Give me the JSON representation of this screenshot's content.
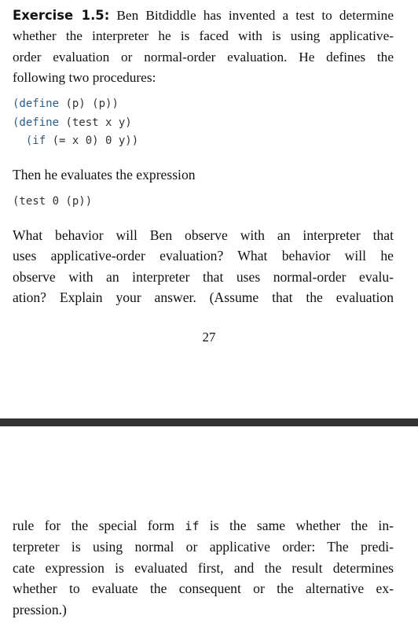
{
  "exercise": {
    "heading": "Exercise 1.5:",
    "intro_lines": [
      "Ben Bitdiddle has invented a test to determine",
      "whether the interpreter he is faced with is using applicative-",
      "order evaluation or normal-order evaluation. He defines the",
      "following two procedures:"
    ]
  },
  "code_block_1": {
    "line_1": {
      "kw": "(define",
      "rest": " (p) (p))"
    },
    "line_2": {
      "kw": "(define",
      "rest": " (test x y)"
    },
    "line_3": {
      "indent": "  ",
      "kw": "(if",
      "rest": " (= x 0) 0 y))"
    }
  },
  "text_2": "Then he evaluates the expression",
  "code_block_2": "(test 0 (p))",
  "question_lines": [
    "What behavior will Ben observe with an interpreter that",
    "uses applicative-order evaluation? What behavior will he",
    "observe with an interpreter that uses normal-order evalu-",
    "ation? Explain your answer. (Assume that the evaluation"
  ],
  "page_number": "27",
  "continuation": {
    "line_1_before": "rule for the special form ",
    "line_1_code": "if",
    "line_1_after": " is the same whether the in-",
    "lines": [
      "terpreter is using normal or applicative order: The predi-",
      "cate expression is evaluated first, and the result determines",
      "whether to evaluate the consequent or the alternative ex-",
      "pression.)"
    ]
  }
}
